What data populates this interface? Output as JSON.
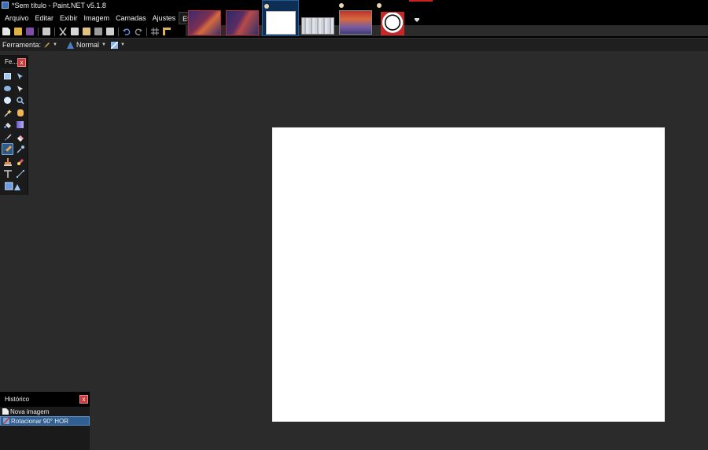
{
  "window": {
    "title": "*Sem título - Paint.NET v5.1.8"
  },
  "menu": [
    "Arquivo",
    "Editar",
    "Exibir",
    "Imagem",
    "Camadas",
    "Ajustes",
    "Efeitos"
  ],
  "toolbar": {
    "icons": [
      "new-icon",
      "open-icon",
      "save-icon",
      "print-icon",
      "cut-icon",
      "copy-icon",
      "paste-icon",
      "crop-icon",
      "deselect-icon",
      "undo-icon",
      "redo-icon",
      "grid-icon",
      "ruler-icon"
    ]
  },
  "options": {
    "tool_label": "Ferramenta:",
    "blend_mode": "Normal"
  },
  "tools_window": {
    "title": "Fe...",
    "close": "x",
    "tools": [
      "rectangle-select",
      "move-selected",
      "lasso-select",
      "move-selection",
      "ellipse-select",
      "zoom",
      "magic-wand",
      "pan",
      "paint-bucket",
      "gradient",
      "paintbrush",
      "eraser",
      "pencil",
      "color-picker",
      "clone-stamp",
      "recolor",
      "text",
      "line-curve",
      "shapes"
    ],
    "selected": "pencil"
  },
  "history": {
    "title": "Histórico",
    "close": "x",
    "items": [
      {
        "label": "Nova imagem",
        "selected": false
      },
      {
        "label": "Rotacionar 90° HOR",
        "selected": true
      }
    ]
  },
  "image_tabs": {
    "count": 6,
    "active_index": 2
  },
  "colors": {
    "accent": "#2f5f93",
    "close": "#c9383a",
    "workspace": "#2b2b2b"
  }
}
